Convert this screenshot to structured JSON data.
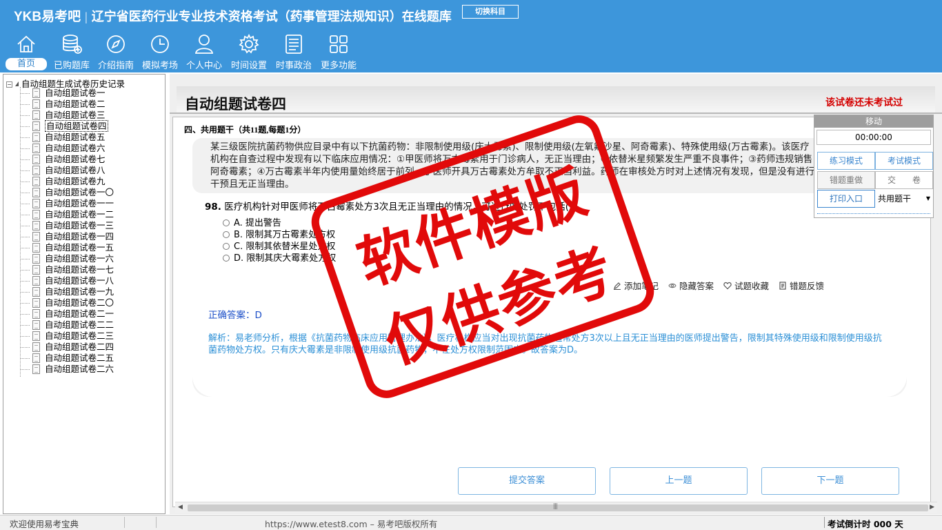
{
  "app": {
    "brand": "YKB易考吧",
    "title": "辽宁省医药行业专业技术资格考试（药事管理法规知识）在线题库",
    "switch_subject": "切换科目"
  },
  "nav": [
    {
      "label": "首页",
      "icon": "home-icon"
    },
    {
      "label": "已购题库",
      "icon": "database-icon"
    },
    {
      "label": "介绍指南",
      "icon": "compass-icon"
    },
    {
      "label": "模拟考场",
      "icon": "clock-icon"
    },
    {
      "label": "个人中心",
      "icon": "user-icon"
    },
    {
      "label": "时间设置",
      "icon": "gear-icon"
    },
    {
      "label": "时事政治",
      "icon": "news-icon"
    },
    {
      "label": "更多功能",
      "icon": "grid-icon"
    }
  ],
  "tree": {
    "root": "自动组题生成试卷历史记录",
    "items": [
      "自动组题试卷一",
      "自动组题试卷二",
      "自动组题试卷三",
      "自动组题试卷四",
      "自动组题试卷五",
      "自动组题试卷六",
      "自动组题试卷七",
      "自动组题试卷八",
      "自动组题试卷九",
      "自动组题试卷一〇",
      "自动组题试卷一一",
      "自动组题试卷一二",
      "自动组题试卷一三",
      "自动组题试卷一四",
      "自动组题试卷一五",
      "自动组题试卷一六",
      "自动组题试卷一七",
      "自动组题试卷一八",
      "自动组题试卷一九",
      "自动组题试卷二〇",
      "自动组题试卷二一",
      "自动组题试卷二二",
      "自动组题试卷二三",
      "自动组题试卷二四",
      "自动组题试卷二五",
      "自动组题试卷二六"
    ],
    "selected_index": 3
  },
  "paper": {
    "title": "自动组题试卷四",
    "status": "该试卷还未考试过",
    "section": "四、共用题干（共11题,每题1分）",
    "stem": "某三级医院抗菌药物供应目录中有以下抗菌药物：非限制使用级(庆大霉素)、限制使用级(左氧氟沙星、阿奇霉素)、特殊使用级(万古霉素)。该医疗机构在自查过程中发现有以下临床应用情况：①甲医师将万古霉素用于门诊病人，无正当理由；②依替米星频繁发生严重不良事件；③药师违规销售阿奇霉素；④万古霉素半年内使用量始终居于前列，丁医师开具万古霉素处方牟取不正当利益。药师在审核处方时对上述情况有发现，但是没有进行干预且无正当理由。",
    "question_no": "98.",
    "question": "医疗机构针对甲医师将万古霉素处方3次且无正当理由的情况，可进行的处罚不包括( )",
    "options": [
      "A. 提出警告",
      "B. 限制其万古霉素处方权",
      "C. 限制其依替米星处方权",
      "D. 限制其庆大霉素处方权"
    ],
    "actions": [
      "添加笔记",
      "隐藏答案",
      "试题收藏",
      "错题反馈"
    ],
    "answer": "正确答案：D",
    "analysis": "解析：易老师分析，根据《抗菌药物临床应用管理办法》，医疗机构应当对出现抗菌药物超常处方3次以上且无正当理由的医师提出警告，限制其特殊使用级和限制使用级抗菌药物处方权。只有庆大霉素是非限制使用级抗菌药物，不在处方权限制范围内。故答案为D。"
  },
  "buttons": {
    "submit": "提交答案",
    "prev": "上一题",
    "next": "下一题"
  },
  "panel": {
    "title": "移动",
    "timer": "00:00:00",
    "practice": "练习模式",
    "exam": "考试模式",
    "redo": "错题重做",
    "hand_in": "交　　卷",
    "print": "打印入口",
    "select": "共用题干"
  },
  "status": {
    "welcome": "欢迎使用易考宝典",
    "url": "https://www.etest8.com – 易考吧版权所有",
    "countdown": "考试倒计时 000 天"
  },
  "watermark": {
    "line1": "软件模版",
    "line2": "仅供参考"
  },
  "colors": {
    "header_bg": "#3d96db",
    "status_red": "#d40000",
    "answer_blue": "#1d4fc8",
    "analysis_blue": "#2b8fd6",
    "stamp_red": "#e10a0a"
  }
}
